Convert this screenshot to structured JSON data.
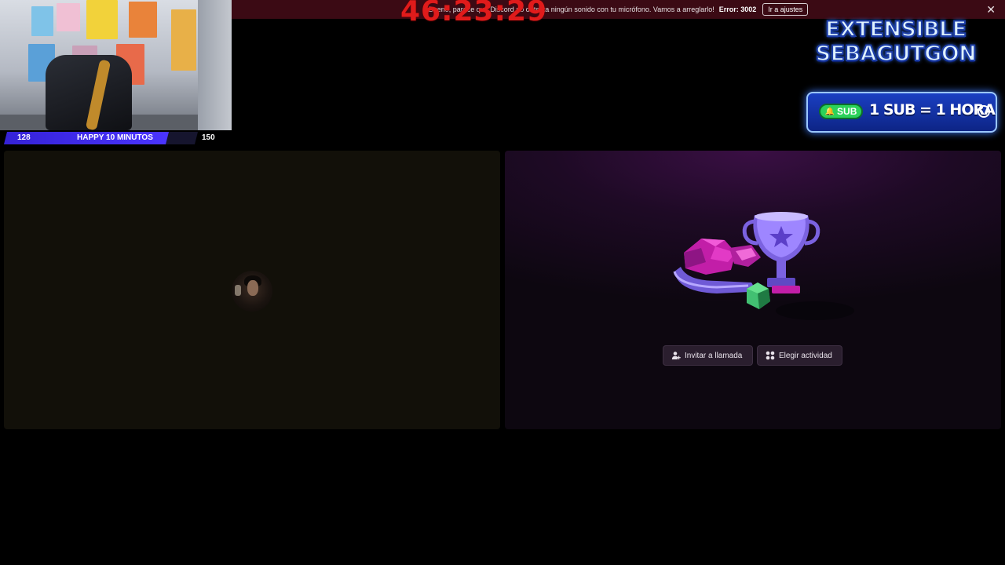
{
  "error_banner": {
    "message": "Bueno, parece que Discord no detecta ningún sonido con tu micrófono. Vamos a arreglarlo!",
    "code": "Error: 3002",
    "button_label": "Ir a ajustes",
    "close_glyph": "✕"
  },
  "overlay": {
    "timer": "46:23:29",
    "happy_bar": {
      "min": "128",
      "title": "HAPPY 10 MINUTOS",
      "max": "150",
      "progress": 0.85
    },
    "logo": {
      "line1": "EXTENSIBLE",
      "line2": "SEBAGUTGON"
    },
    "sub_banner": {
      "pill": "SUB",
      "text": "1 SUB = 1 HORA"
    }
  },
  "call": {
    "invite_label": "Invitar a llamada",
    "activity_label": "Elegir actividad"
  },
  "colors": {
    "timer": "#e01b1b",
    "banner_bg": "#3b0a14",
    "happy_fill": "#4a34ff",
    "sub_pill": "#2bd15a"
  },
  "icons": {
    "close": "close-icon",
    "bell": "bell-icon",
    "clock": "alarm-clock-icon",
    "invite": "add-user-icon",
    "activity": "activity-grid-icon"
  }
}
